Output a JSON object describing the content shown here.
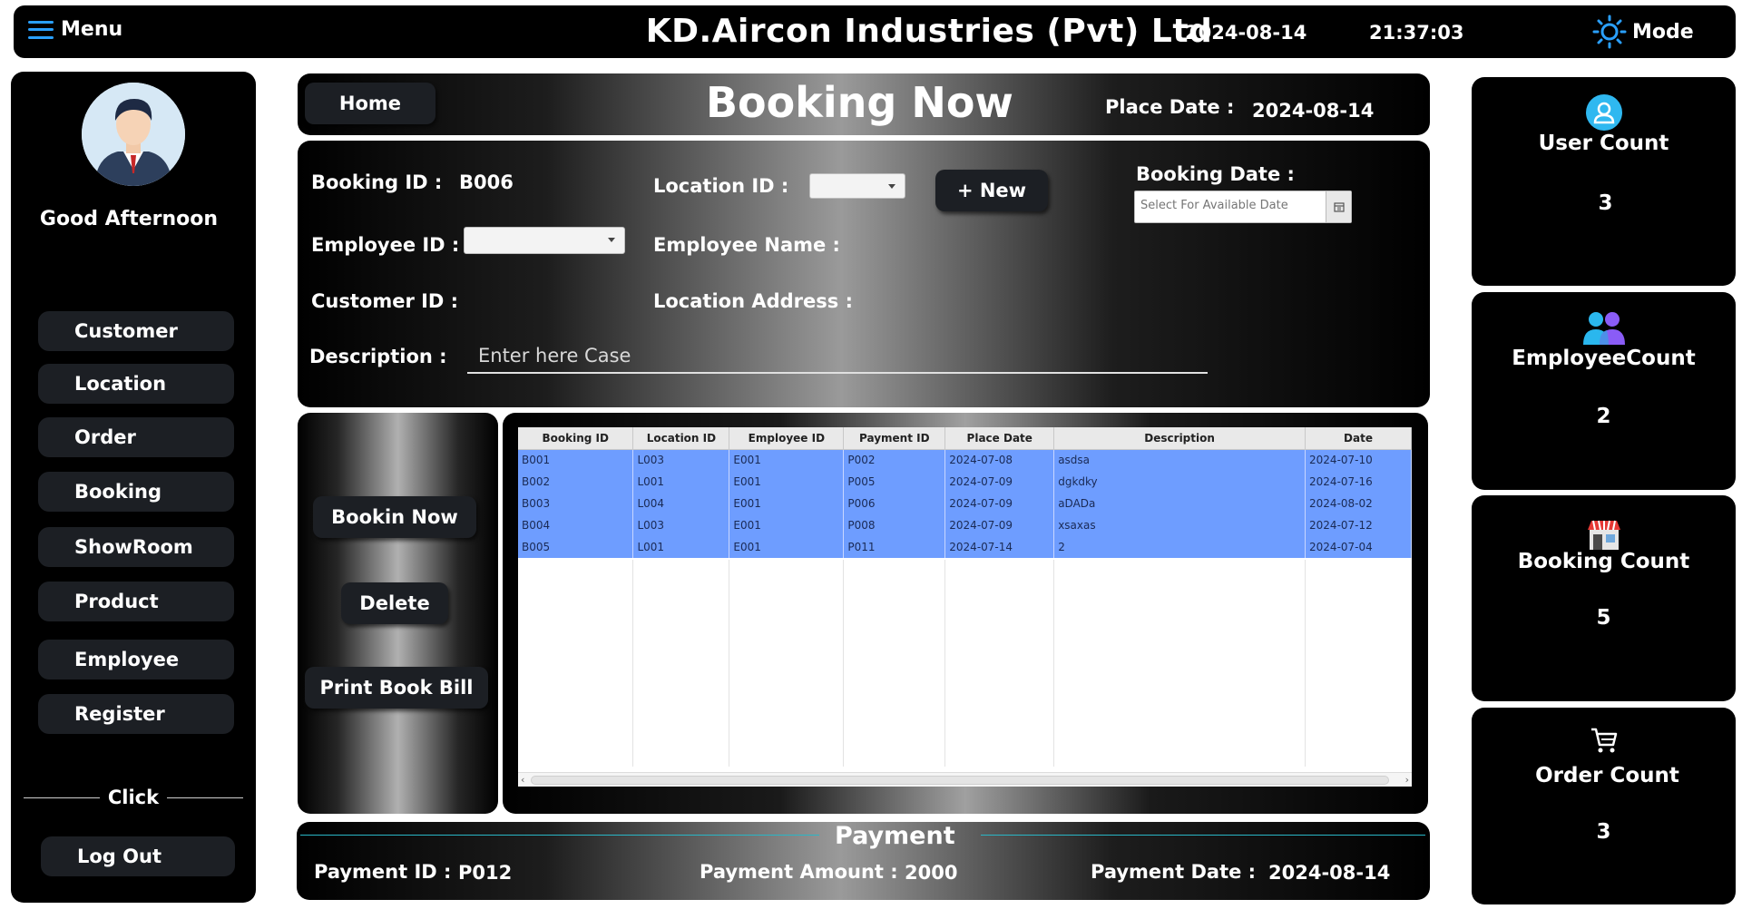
{
  "topbar": {
    "menu_label": "Menu",
    "title": "KD.Aircon Industries (Pvt) Ltd",
    "date": "2024-08-14",
    "time": "21:37:03",
    "mode_label": "Mode"
  },
  "sidebar": {
    "greeting": "Good Afternoon",
    "items": [
      {
        "label": "Customer"
      },
      {
        "label": "Location"
      },
      {
        "label": "Order"
      },
      {
        "label": "Booking"
      },
      {
        "label": "ShowRoom"
      },
      {
        "label": "Product"
      },
      {
        "label": "Employee"
      },
      {
        "label": "Register"
      }
    ],
    "click_label": "Click",
    "logout_label": "Log Out"
  },
  "header": {
    "home_label": "Home",
    "page_title": "Booking Now",
    "place_date_label": "Place Date :",
    "place_date_value": "2024-08-14"
  },
  "form": {
    "booking_id_label": "Booking ID :",
    "booking_id_value": "B006",
    "location_id_label": "Location ID :",
    "new_label": "+  New",
    "booking_date_label": "Booking Date :",
    "booking_date_placeholder": "Select For Available Date",
    "employee_id_label": "Employee ID :",
    "employee_name_label": "Employee Name :",
    "customer_id_label": "Customer ID :",
    "location_address_label": "Location Address :",
    "description_label": "Description :",
    "description_placeholder": "Enter here Case"
  },
  "actions": {
    "booking_now_label": "Bookin Now",
    "delete_label": "Delete",
    "print_label": "Print Book Bill"
  },
  "table": {
    "headers": [
      "Booking ID",
      "Location ID",
      "Employee ID",
      "Payment ID",
      "Place Date",
      "Description",
      "Date"
    ],
    "rows": [
      [
        "B001",
        "L003",
        "E001",
        "P002",
        "2024-07-08",
        "asdsa",
        "2024-07-10"
      ],
      [
        "B002",
        "L001",
        "E001",
        "P005",
        "2024-07-09",
        "dgkdky",
        "2024-07-16"
      ],
      [
        "B003",
        "L004",
        "E001",
        "P006",
        "2024-07-09",
        "aDADa",
        "2024-08-02"
      ],
      [
        "B004",
        "L003",
        "E001",
        "P008",
        "2024-07-09",
        "xsaxas",
        "2024-07-12"
      ],
      [
        "B005",
        "L001",
        "E001",
        "P011",
        "2024-07-14",
        "2",
        "2024-07-04"
      ]
    ]
  },
  "payment": {
    "title": "Payment",
    "payment_id_label": "Payment ID :",
    "payment_id_value": "P012",
    "amount_label": "Payment Amount :",
    "amount_value": "2000",
    "date_label": "Payment Date :",
    "date_value": "2024-08-14"
  },
  "cards": {
    "user_count_label": "User Count",
    "user_count_value": "3",
    "employee_count_label": "EmployeeCount",
    "employee_count_value": "2",
    "booking_count_label": "Booking Count",
    "booking_count_value": "5",
    "order_count_label": "Order Count",
    "order_count_value": "3"
  },
  "icons": {
    "menu": "hamburger-icon",
    "mode": "sun-icon",
    "user": "user-icon",
    "employees": "people-icon",
    "booking": "store-icon",
    "order": "cart-icon",
    "calendar": "calendar-icon"
  },
  "colors": {
    "accent_blue": "#2aa0ff",
    "selected_row": "#6e9dff",
    "payment_line": "#29b6c6"
  }
}
